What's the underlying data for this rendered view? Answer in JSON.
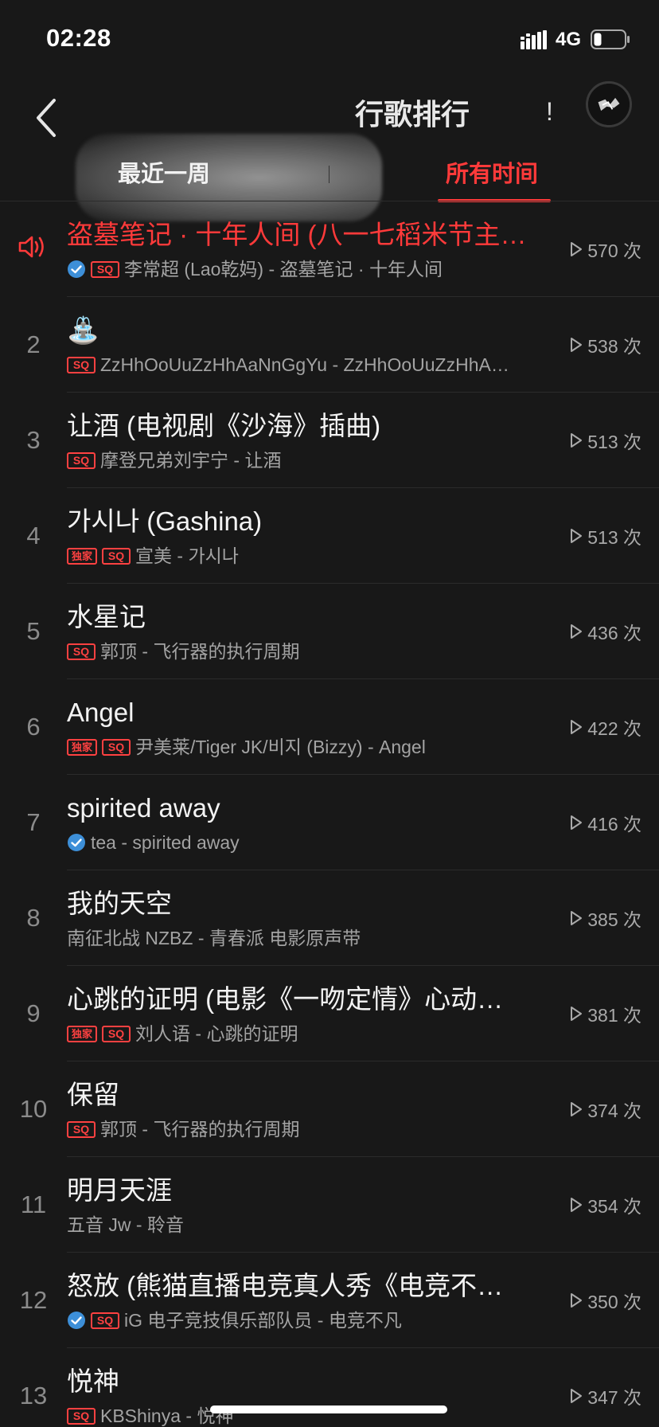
{
  "status_bar": {
    "time": "02:28",
    "network": "4G",
    "signal_icon": "signal-icon",
    "battery_icon": "battery-icon"
  },
  "header": {
    "title_visible": "行歌排行",
    "title_suffix_glyph": "!",
    "back_icon": "chevron-left-icon",
    "avatar_icon": "avatar"
  },
  "tabs": [
    {
      "label": "最近一周",
      "active": false
    },
    {
      "label": "所有时间",
      "active": true
    }
  ],
  "colors": {
    "accent": "#ff3a3a",
    "background": "#181818",
    "text_primary": "#f3f3f3",
    "text_secondary": "#a3a3a3",
    "verified": "#3d8fd8"
  },
  "songs": [
    {
      "rank": "1",
      "playing": true,
      "title": "盗墓笔记 · 十年人间 (八一七稻米节主…",
      "badges": [
        "verified",
        "SQ"
      ],
      "subtitle": "李常超 (Lao乾妈) - 盗墓笔记 · 十年人间",
      "plays": "570 次"
    },
    {
      "rank": "2",
      "title": "⛲",
      "badges": [
        "SQ"
      ],
      "subtitle": "ZzHhOoUuZzHhAaNnGgYu - ZzHhOoUuZzHhA…",
      "plays": "538 次"
    },
    {
      "rank": "3",
      "title": "让酒 (电视剧《沙海》插曲)",
      "badges": [
        "SQ"
      ],
      "subtitle": "摩登兄弟刘宇宁 - 让酒",
      "plays": "513 次"
    },
    {
      "rank": "4",
      "title": "가시나 (Gashina)",
      "badges": [
        "独家",
        "SQ"
      ],
      "subtitle": "宣美 - 가시나",
      "plays": "513 次"
    },
    {
      "rank": "5",
      "title": "水星记",
      "badges": [
        "SQ"
      ],
      "subtitle": "郭顶 - 飞行器的执行周期",
      "plays": "436 次"
    },
    {
      "rank": "6",
      "title": "Angel",
      "badges": [
        "独家",
        "SQ"
      ],
      "subtitle": "尹美莱/Tiger JK/비지 (Bizzy) - Angel",
      "plays": "422 次"
    },
    {
      "rank": "7",
      "title": "spirited away",
      "badges": [
        "verified"
      ],
      "subtitle": "tea - spirited away",
      "plays": "416 次"
    },
    {
      "rank": "8",
      "title": "我的天空",
      "badges": [],
      "subtitle": "南征北战 NZBZ - 青春派 电影原声带",
      "plays": "385 次"
    },
    {
      "rank": "9",
      "title": "心跳的证明 (电影《一吻定情》心动…",
      "badges": [
        "独家",
        "SQ"
      ],
      "subtitle": "刘人语 - 心跳的证明",
      "plays": "381 次"
    },
    {
      "rank": "10",
      "title": "保留",
      "badges": [
        "SQ"
      ],
      "subtitle": "郭顶 - 飞行器的执行周期",
      "plays": "374 次"
    },
    {
      "rank": "11",
      "title": "明月天涯",
      "badges": [],
      "subtitle": "五音 Jw - 聆音",
      "plays": "354 次"
    },
    {
      "rank": "12",
      "title": "怒放 (熊猫直播电竞真人秀《电竞不…",
      "badges": [
        "verified",
        "SQ"
      ],
      "subtitle": "iG 电子竞技俱乐部队员 - 电竞不凡",
      "plays": "350 次"
    },
    {
      "rank": "13",
      "title": "悦神",
      "badges": [
        "SQ"
      ],
      "subtitle": "KBShinya - 悦神",
      "plays": "347 次"
    }
  ]
}
